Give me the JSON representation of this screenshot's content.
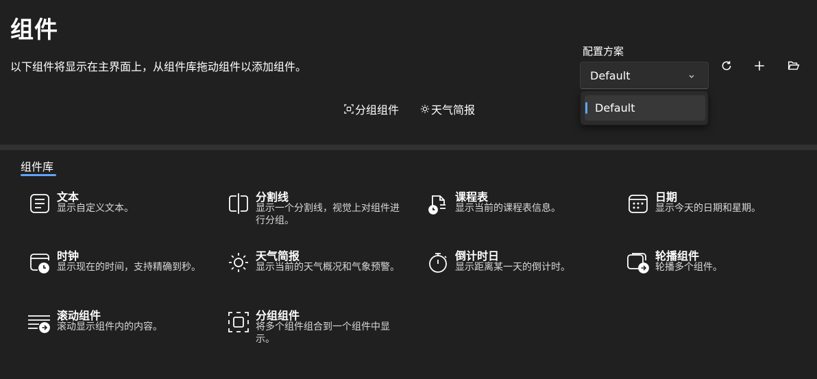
{
  "page": {
    "title": "组件",
    "subtitle": "以下组件将显示在主界面上，从组件库拖动组件以添加组件。"
  },
  "preview": {
    "items": [
      {
        "label": "分组组件",
        "icon": "group-icon"
      },
      {
        "label": "天气简报",
        "icon": "sun-icon"
      }
    ]
  },
  "profile": {
    "label": "配置方案",
    "selected": "Default",
    "options": [
      "Default"
    ],
    "actions": [
      "refresh-icon",
      "plus-icon",
      "folder-icon"
    ]
  },
  "library": {
    "tab_label": "组件库",
    "widgets": [
      {
        "name": "文本",
        "desc": "显示自定义文本。",
        "icon": "text-icon"
      },
      {
        "name": "分割线",
        "desc": "显示一个分割线，视觉上对组件进行分组。",
        "icon": "separator-icon"
      },
      {
        "name": "课程表",
        "desc": "显示当前的课程表信息。",
        "icon": "schedule-icon"
      },
      {
        "name": "日期",
        "desc": "显示今天的日期和星期。",
        "icon": "calendar-icon"
      },
      {
        "name": "时钟",
        "desc": "显示现在的时间，支持精确到秒。",
        "icon": "clock-icon"
      },
      {
        "name": "天气简报",
        "desc": "显示当前的天气概况和气象预警。",
        "icon": "sun-icon"
      },
      {
        "name": "倒计时日",
        "desc": "显示距离某一天的倒计时。",
        "icon": "timer-icon"
      },
      {
        "name": "轮播组件",
        "desc": "轮播多个组件。",
        "icon": "carousel-icon"
      },
      {
        "name": "滚动组件",
        "desc": "滚动显示组件内的内容。",
        "icon": "scroll-icon"
      },
      {
        "name": "分组组件",
        "desc": "将多个组件组合到一个组件中显示。",
        "icon": "group-icon"
      }
    ]
  },
  "colors": {
    "background": "#202020",
    "divider": "#323232",
    "accent": "#60a5fa"
  }
}
